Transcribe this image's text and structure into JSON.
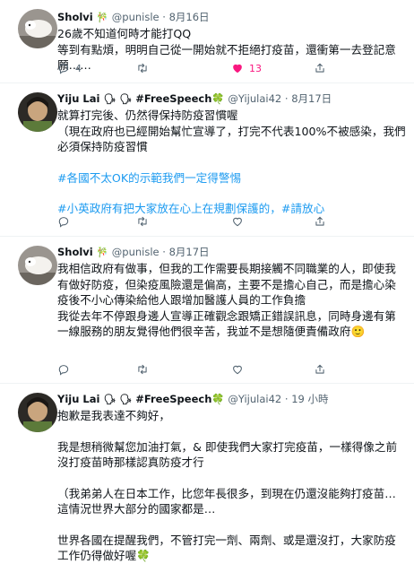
{
  "tweets": [
    {
      "name": "Sholvi",
      "badges": "🎋",
      "handle": "@punisle",
      "date": "· 8月16日",
      "text": [
        "26歲不知道何時才能打QQ",
        "等到有點煩，明明自己從一開始就不拒絕打疫苗，還衝第一去登記意願……"
      ],
      "reply_count": "4",
      "retweet_count": "",
      "like_count": "13",
      "liked": true
    },
    {
      "name": "Yiju Lai",
      "badges": "🗣 🗣",
      "display_tag": "#FreeSpeech",
      "tag_emoji": "🍀",
      "handle": "@Yijulai42",
      "date": "· 8月17日",
      "text": [
        "就算打完後、仍然得保持防疫習慣喔",
        "（現在政府也已經開始幫忙宣導了，打完不代表100%不被感染，我們必須保持防疫習慣",
        "#各國不太OK的示範我們一定得警惕",
        "#小英政府有把大家放在心上在規劃保護的，#請放心"
      ],
      "reply_count": "",
      "retweet_count": "",
      "like_count": "",
      "liked": false
    },
    {
      "name": "Sholvi",
      "badges": "🎋",
      "handle": "@punisle",
      "date": "· 8月17日",
      "text": [
        "我相信政府有做事，但我的工作需要長期接觸不同職業的人，即使我有做好防疫，但染疫風險還是偏高，主要不是擔心自己，而是擔心染疫後不小心傳染給他人跟增加醫護人員的工作負擔",
        "我從去年不停跟身邊人宣導正確觀念跟矯正錯誤訊息，同時身邊有第一線服務的朋友覺得他們很辛苦，我並不是想隨便責備政府🙂"
      ],
      "reply_count": "",
      "retweet_count": "",
      "like_count": "",
      "liked": false
    },
    {
      "name": "Yiju Lai",
      "badges": "🗣 🗣",
      "display_tag": "#FreeSpeech",
      "tag_emoji": "🍀",
      "handle": "@Yijulai42",
      "date": "· 19 小時",
      "text": [
        "抱歉是我表達不夠好，",
        "我是想稍微幫您加油打氣，& 即使我們大家打完疫苗，一樣得像之前沒打疫苗時那樣認真防疫才行",
        "（我弟弟人在日本工作，比您年長很多，到現在仍還沒能夠打疫苗…這情況世界大部分的國家都是…",
        "世界各國在提醒我們，不管打完一劑、兩劑、或是還沒打，大家防疫工作仍得做好喔🍀"
      ],
      "reply_count": "",
      "retweet_count": "",
      "like_count": "",
      "liked": false
    }
  ],
  "colors": {
    "text": "#0f1419",
    "secondary": "#536471",
    "hashtag": "#1d9bf0",
    "like": "#f91880",
    "divider": "#eff3f4"
  },
  "icons": {
    "reply": "comment-bubble-icon",
    "retweet": "retweet-arrows-icon",
    "like": "heart-icon",
    "share": "share-upload-icon"
  }
}
